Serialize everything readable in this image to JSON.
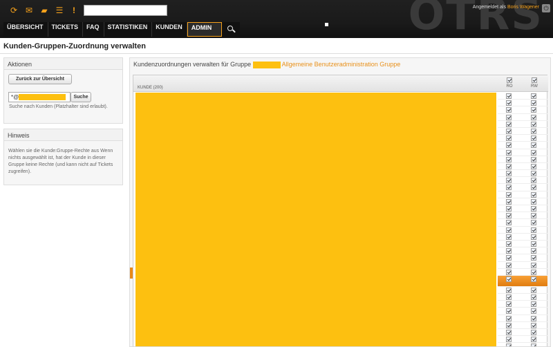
{
  "header": {
    "logo_text": "OTRS",
    "user_prefix": "Angemeldet als",
    "user_name": "Boris Wagener",
    "toolbar_icons": [
      "refresh-icon",
      "mail-icon",
      "folder-icon",
      "list-icon",
      "exclamation-icon"
    ]
  },
  "nav": {
    "items": [
      "ÜBERSICHT",
      "TICKETS",
      "FAQ",
      "STATISTIKEN",
      "KUNDEN",
      "ADMIN"
    ],
    "selected": "ADMIN"
  },
  "page": {
    "title": "Kunden-Gruppen-Zuordnung verwalten"
  },
  "sidebar": {
    "actions": {
      "title": "Aktionen",
      "back_button": "Zurück zur Übersicht",
      "search_value": "*@",
      "search_button": "Suche",
      "search_hint": "Suche nach Kunden (Platzhalter sind erlaubt)."
    },
    "hint": {
      "title": "Hinweis",
      "text": "Wählen sie die Kunde:Gruppe-Rechte aus Wenn nichts ausgewählt ist, hat der Kunde in dieser Gruppe keine Rechte (und kann nicht auf Tickets zugreifen)."
    }
  },
  "main": {
    "heading_prefix": "Kundenzuordnungen verwalten für Gruppe",
    "group_name": "Allgemeine Benutzeradministration Gruppe",
    "table": {
      "column_customer": "KUNDE (200)",
      "column_ro": "RO",
      "column_rw": "RW"
    }
  },
  "colors": {
    "accent": "#f7a21b",
    "redaction": "#fdc010",
    "topbar": "#1a1a1a"
  }
}
